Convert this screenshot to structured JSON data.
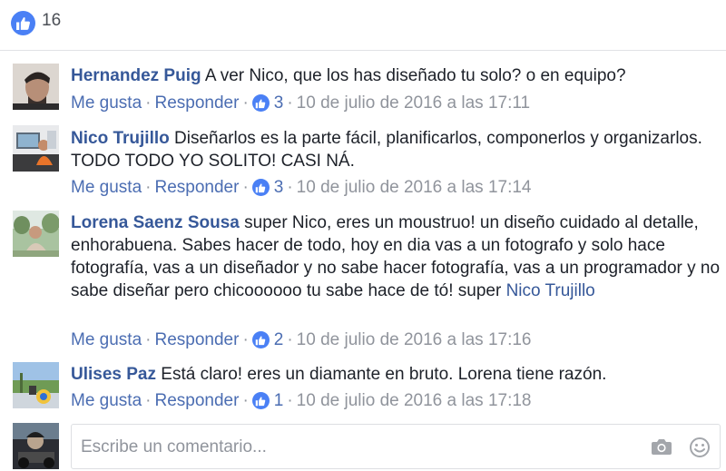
{
  "reactions": {
    "like_count": "16",
    "like_icon": "thumbs-up-icon",
    "accent_color": "#4a80f5"
  },
  "comments": [
    {
      "author": "Hernandez Puig",
      "text": "A ver Nico, que los has diseñado tu solo? o en equipo?",
      "like_label": "Me gusta",
      "reply_label": "Responder",
      "reaction_count": "3",
      "timestamp": "10 de julio de 2016 a las 17:11"
    },
    {
      "author": "Nico Trujillo",
      "text": "Diseñarlos es la parte fácil, planificarlos, componerlos y organizarlos. TODO TODO YO SOLITO! CASI NÁ.",
      "like_label": "Me gusta",
      "reply_label": "Responder",
      "reaction_count": "3",
      "timestamp": "10 de julio de 2016 a las 17:14"
    },
    {
      "author": "Lorena Saenz Sousa",
      "text": "super Nico, eres un moustruo! un diseño cuidado al detalle, enhorabuena. Sabes hacer de todo, hoy en dia vas a un fotografo y solo hace fotografía, vas a un diseñador y no sabe hacer fotografía, vas a un programador y no sabe diseñar pero chicoooooo tu sabe hace de tó! super",
      "mention": "Nico Trujillo",
      "like_label": "Me gusta",
      "reply_label": "Responder",
      "reaction_count": "2",
      "timestamp": "10 de julio de 2016 a las 17:16"
    },
    {
      "author": "Ulises Paz",
      "text": "Está claro! eres un diamante en bruto. Lorena tiene razón.",
      "like_label": "Me gusta",
      "reply_label": "Responder",
      "reaction_count": "1",
      "timestamp": "10 de julio de 2016 a las 17:18"
    }
  ],
  "composer": {
    "placeholder": "Escribe un comentario...",
    "camera_icon": "camera-icon",
    "emoji_icon": "smiley-icon"
  },
  "separator": "·",
  "colors": {
    "link": "#365899",
    "meta": "#90949c",
    "action": "#4b6db2"
  }
}
